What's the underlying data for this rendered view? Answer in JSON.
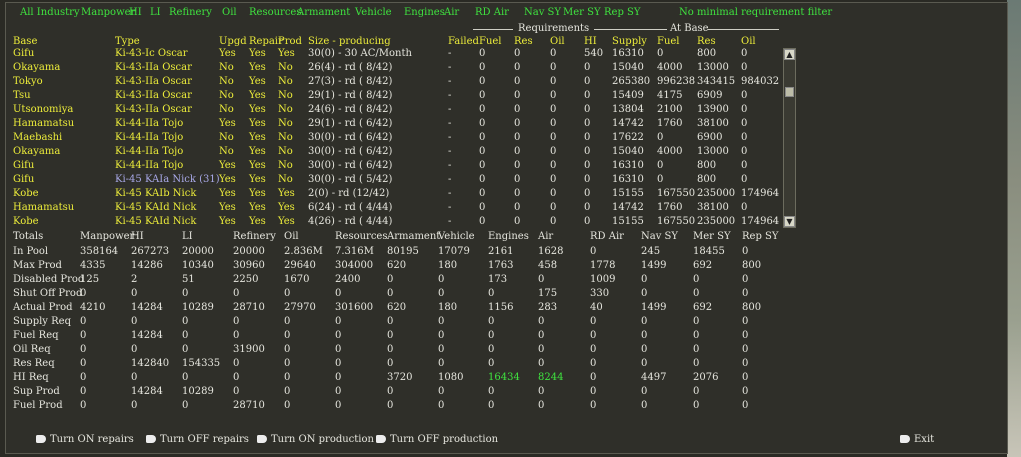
{
  "filters": [
    "All Industry",
    "Manpower",
    "HI",
    "LI",
    "Refinery",
    "Oil",
    "Resources",
    "Armament",
    "Vehicle",
    "Engines",
    "Air",
    "RD Air",
    "Nav SY",
    "Mer SY",
    "Rep SY",
    "No minimal requirement filter"
  ],
  "group_headers": {
    "requirements": "Requirements",
    "at_base": "At Base"
  },
  "columns": [
    "Base",
    "Type",
    "Upgd",
    "Repair",
    "Prod",
    "Size - producing",
    "Failed",
    "Fuel",
    "Res",
    "Oil",
    "HI",
    "Supply",
    "Fuel",
    "Res",
    "Oil"
  ],
  "rows": [
    {
      "base": "Gifu",
      "type": "Ki-43-Ic Oscar",
      "upgd": "Yes",
      "repair": "Yes",
      "prod": "Yes",
      "size": "30(0) - 30 AC/Month",
      "failed": "-",
      "rfuel": "0",
      "rres": "0",
      "roil": "0",
      "hi": "540",
      "supply": "16310",
      "bfuel": "0",
      "bres": "800",
      "boil": "0"
    },
    {
      "base": "Okayama",
      "type": "Ki-43-IIa Oscar",
      "upgd": "No",
      "repair": "Yes",
      "prod": "No",
      "size": "26(4) - rd ( 8/42)",
      "failed": "-",
      "rfuel": "0",
      "rres": "0",
      "roil": "0",
      "hi": "0",
      "supply": "15040",
      "bfuel": "4000",
      "bres": "13000",
      "boil": "0"
    },
    {
      "base": "Tokyo",
      "type": "Ki-43-IIa Oscar",
      "upgd": "No",
      "repair": "Yes",
      "prod": "No",
      "size": "27(3) - rd ( 8/42)",
      "failed": "-",
      "rfuel": "0",
      "rres": "0",
      "roil": "0",
      "hi": "0",
      "supply": "265380",
      "bfuel": "996238",
      "bres": "343415",
      "boil": "984032"
    },
    {
      "base": "Tsu",
      "type": "Ki-43-IIa Oscar",
      "upgd": "No",
      "repair": "Yes",
      "prod": "No",
      "size": "29(1) - rd ( 8/42)",
      "failed": "-",
      "rfuel": "0",
      "rres": "0",
      "roil": "0",
      "hi": "0",
      "supply": "15409",
      "bfuel": "4175",
      "bres": "6909",
      "boil": "0"
    },
    {
      "base": "Utsonomiya",
      "type": "Ki-43-IIa Oscar",
      "upgd": "No",
      "repair": "Yes",
      "prod": "No",
      "size": "24(6) - rd ( 8/42)",
      "failed": "-",
      "rfuel": "0",
      "rres": "0",
      "roil": "0",
      "hi": "0",
      "supply": "13804",
      "bfuel": "2100",
      "bres": "13900",
      "boil": "0"
    },
    {
      "base": "Hamamatsu",
      "type": "Ki-44-IIa Tojo",
      "upgd": "Yes",
      "repair": "Yes",
      "prod": "No",
      "size": "29(1) - rd ( 6/42)",
      "failed": "-",
      "rfuel": "0",
      "rres": "0",
      "roil": "0",
      "hi": "0",
      "supply": "14742",
      "bfuel": "1760",
      "bres": "38100",
      "boil": "0"
    },
    {
      "base": "Maebashi",
      "type": "Ki-44-IIa Tojo",
      "upgd": "No",
      "repair": "Yes",
      "prod": "No",
      "size": "30(0) - rd ( 6/42)",
      "failed": "-",
      "rfuel": "0",
      "rres": "0",
      "roil": "0",
      "hi": "0",
      "supply": "17622",
      "bfuel": "0",
      "bres": "6900",
      "boil": "0"
    },
    {
      "base": "Okayama",
      "type": "Ki-44-IIa Tojo",
      "upgd": "No",
      "repair": "Yes",
      "prod": "No",
      "size": "30(0) - rd ( 6/42)",
      "failed": "-",
      "rfuel": "0",
      "rres": "0",
      "roil": "0",
      "hi": "0",
      "supply": "15040",
      "bfuel": "4000",
      "bres": "13000",
      "boil": "0"
    },
    {
      "base": "Gifu",
      "type": "Ki-44-IIa Tojo",
      "upgd": "Yes",
      "repair": "Yes",
      "prod": "No",
      "size": "30(0) - rd ( 6/42)",
      "failed": "-",
      "rfuel": "0",
      "rres": "0",
      "roil": "0",
      "hi": "0",
      "supply": "16310",
      "bfuel": "0",
      "bres": "800",
      "boil": "0"
    },
    {
      "base": "Gifu",
      "type": "Ki-45 KAIa Nick (31)",
      "upgd": "Yes",
      "repair": "Yes",
      "prod": "No",
      "size": "30(0) - rd ( 5/42)",
      "failed": "-",
      "rfuel": "0",
      "rres": "0",
      "roil": "0",
      "hi": "0",
      "supply": "16310",
      "bfuel": "0",
      "bres": "800",
      "boil": "0",
      "highlight": true
    },
    {
      "base": "Kobe",
      "type": "Ki-45 KAIb Nick",
      "upgd": "Yes",
      "repair": "Yes",
      "prod": "Yes",
      "size": "2(0) - rd (12/42)",
      "failed": "-",
      "rfuel": "0",
      "rres": "0",
      "roil": "0",
      "hi": "0",
      "supply": "15155",
      "bfuel": "167550",
      "bres": "235000",
      "boil": "174964"
    },
    {
      "base": "Hamamatsu",
      "type": "Ki-45 KAId Nick",
      "upgd": "Yes",
      "repair": "Yes",
      "prod": "Yes",
      "size": "6(24) - rd ( 4/44)",
      "failed": "-",
      "rfuel": "0",
      "rres": "0",
      "roil": "0",
      "hi": "0",
      "supply": "14742",
      "bfuel": "1760",
      "bres": "38100",
      "boil": "0"
    },
    {
      "base": "Kobe",
      "type": "Ki-45 KAId Nick",
      "upgd": "Yes",
      "repair": "Yes",
      "prod": "Yes",
      "size": "4(26) - rd ( 4/44)",
      "failed": "-",
      "rfuel": "0",
      "rres": "0",
      "roil": "0",
      "hi": "0",
      "supply": "15155",
      "bfuel": "167550",
      "bres": "235000",
      "boil": "174964"
    }
  ],
  "totals_columns": [
    "Totals",
    "Manpower",
    "HI",
    "LI",
    "Refinery",
    "Oil",
    "Resources",
    "Armament",
    "Vehicle",
    "Engines",
    "Air",
    "RD Air",
    "Nav SY",
    "Mer SY",
    "Rep SY"
  ],
  "totals": [
    {
      "label": "In Pool",
      "v": [
        "358164",
        "267273",
        "20000",
        "20000",
        "2.836M",
        "7.316M",
        "80195",
        "17079",
        "2161",
        "1628",
        "0",
        "245",
        "18455",
        "0"
      ]
    },
    {
      "label": "Max Prod",
      "v": [
        "4335",
        "14286",
        "10340",
        "30960",
        "29640",
        "304000",
        "620",
        "180",
        "1763",
        "458",
        "1778",
        "1499",
        "692",
        "800"
      ]
    },
    {
      "label": "Disabled Prod",
      "v": [
        "125",
        "2",
        "51",
        "2250",
        "1670",
        "2400",
        "0",
        "0",
        "173",
        "0",
        "1009",
        "0",
        "0",
        "0"
      ]
    },
    {
      "label": "Shut Off Prod",
      "v": [
        "0",
        "0",
        "0",
        "0",
        "0",
        "0",
        "0",
        "0",
        "0",
        "175",
        "330",
        "0",
        "0",
        "0"
      ]
    },
    {
      "label": "Actual Prod",
      "v": [
        "4210",
        "14284",
        "10289",
        "28710",
        "27970",
        "301600",
        "620",
        "180",
        "1156",
        "283",
        "40",
        "1499",
        "692",
        "800"
      ]
    },
    {
      "label": "Supply Req",
      "v": [
        "0",
        "0",
        "0",
        "0",
        "0",
        "0",
        "0",
        "0",
        "0",
        "0",
        "0",
        "0",
        "0",
        "0"
      ]
    },
    {
      "label": "Fuel Req",
      "v": [
        "0",
        "14284",
        "0",
        "0",
        "0",
        "0",
        "0",
        "0",
        "0",
        "0",
        "0",
        "0",
        "0",
        "0"
      ]
    },
    {
      "label": "Oil Req",
      "v": [
        "0",
        "0",
        "0",
        "31900",
        "0",
        "0",
        "0",
        "0",
        "0",
        "0",
        "0",
        "0",
        "0",
        "0"
      ]
    },
    {
      "label": "Res Req",
      "v": [
        "0",
        "142840",
        "154335",
        "0",
        "0",
        "0",
        "0",
        "0",
        "0",
        "0",
        "0",
        "0",
        "0",
        "0"
      ]
    },
    {
      "label": "HI Req",
      "v": [
        "0",
        "0",
        "0",
        "0",
        "0",
        "0",
        "3720",
        "1080",
        "16434",
        "8244",
        "0",
        "4497",
        "2076",
        "0"
      ],
      "green_idx": [
        8,
        9
      ]
    },
    {
      "label": "Sup Prod",
      "v": [
        "0",
        "14284",
        "10289",
        "0",
        "0",
        "0",
        "0",
        "0",
        "0",
        "0",
        "0",
        "0",
        "0",
        "0"
      ]
    },
    {
      "label": "Fuel Prod",
      "v": [
        "0",
        "0",
        "0",
        "28710",
        "0",
        "0",
        "0",
        "0",
        "0",
        "0",
        "0",
        "0",
        "0",
        "0"
      ]
    }
  ],
  "actions": [
    "Turn ON repairs",
    "Turn OFF repairs",
    "Turn ON production",
    "Turn OFF production"
  ],
  "exit_label": "Exit",
  "colors": {
    "accent_green": "#3fe23f",
    "header_yellow": "#ecec3a",
    "highlight_blue": "#a9a9e8",
    "text": "#e6e6de",
    "panel": "#2f2f29"
  }
}
